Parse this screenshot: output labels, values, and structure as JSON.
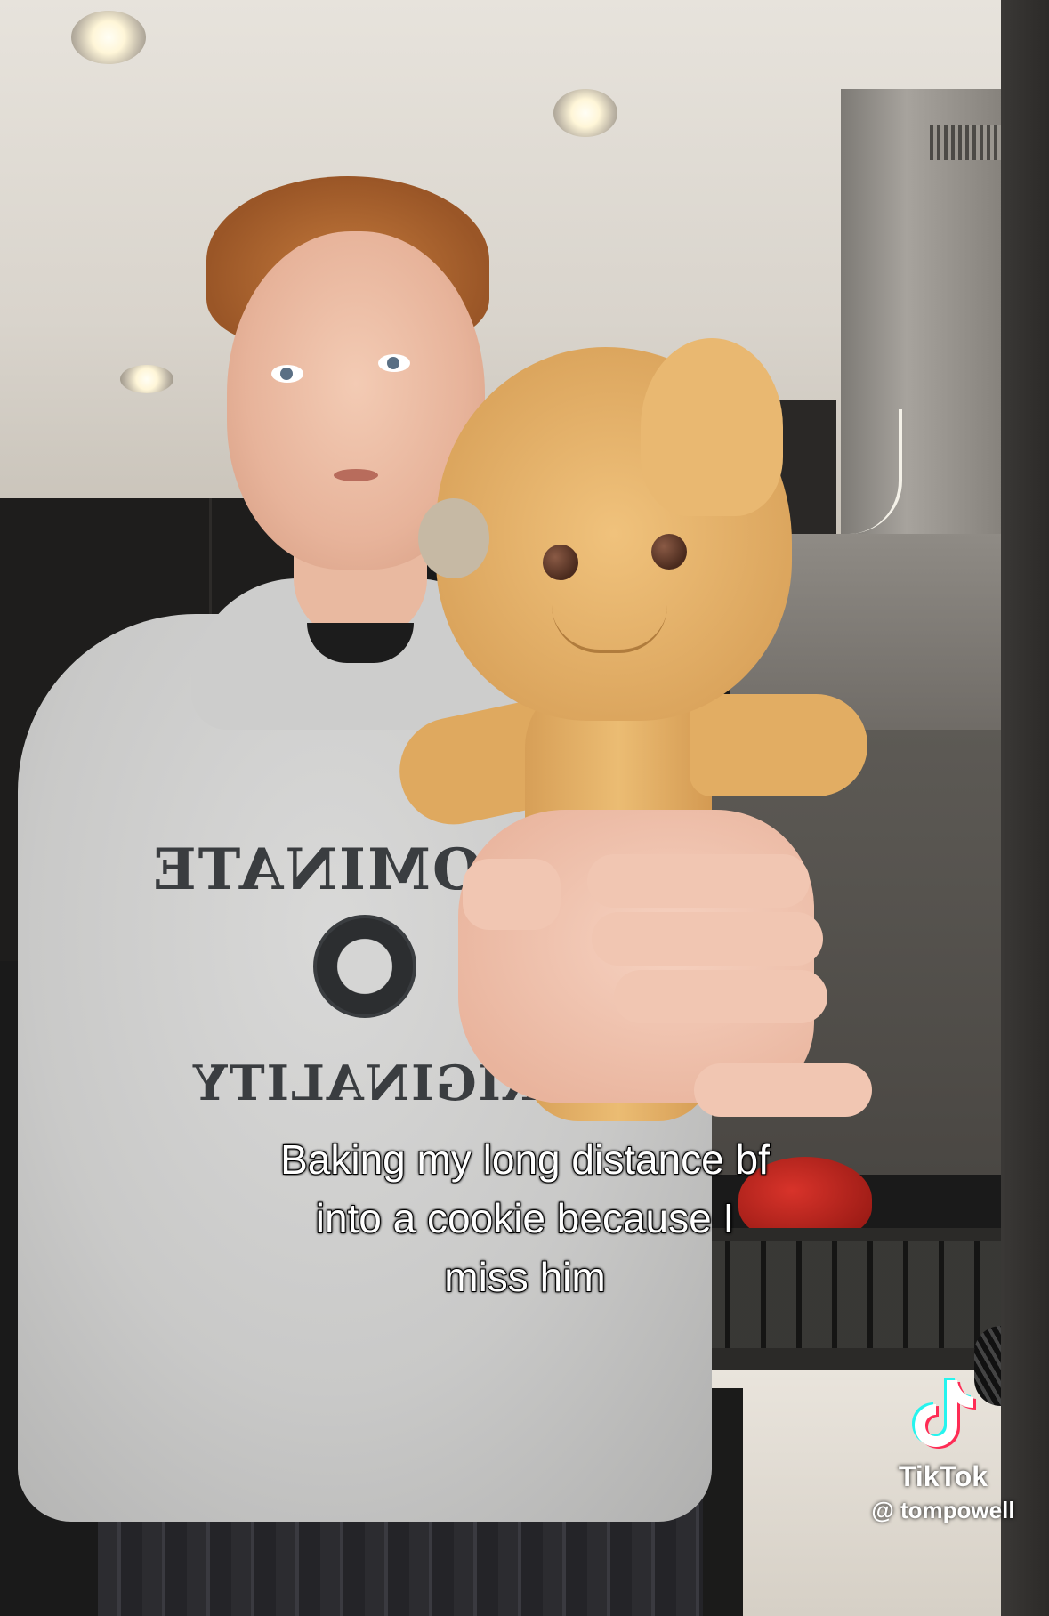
{
  "caption": {
    "line1": "Baking my long distance bf",
    "line2": "into a cookie because I",
    "line3": "miss him"
  },
  "hoodie_print": {
    "top": "DOMINATE",
    "bottom": "ORIGINALITY"
  },
  "watermark": {
    "brand": "TikTok",
    "username": "@ tompowell",
    "icon": "tiktok-logo-icon"
  },
  "colors": {
    "caption_text": "#ffffff",
    "caption_outline": "#000000",
    "cookie": "#e2ad63",
    "kettle": "#c8281f"
  }
}
